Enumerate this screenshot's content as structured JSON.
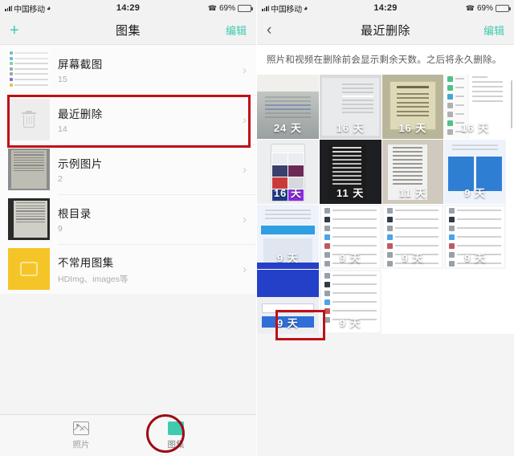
{
  "status_bar": {
    "carrier": "中国移动",
    "time": "14:29",
    "battery_percent": "69%",
    "battery_level": 69,
    "wifi_icon": "wifi-icon",
    "signal_icon": "signal-bars-icon",
    "call_icon": "call-forward-icon",
    "battery_icon": "battery-charging-icon"
  },
  "left_screen": {
    "nav": {
      "add_label": "+",
      "title": "图集",
      "edit_label": "编辑",
      "add_icon": "plus-icon"
    },
    "albums": [
      {
        "name": "屏幕截图",
        "count": "15",
        "thumb": "list-screenshot",
        "chevron": "›"
      },
      {
        "name": "最近删除",
        "count": "14",
        "thumb": "trash-icon",
        "chevron": "›",
        "highlighted": true
      },
      {
        "name": "示例图片",
        "count": "2",
        "thumb": "document-photo",
        "chevron": "›"
      },
      {
        "name": "根目录",
        "count": "9",
        "thumb": "document-photo-dark",
        "chevron": "›"
      },
      {
        "name": "不常用图集",
        "count": "HDImg、images等",
        "thumb": "yellow-folder",
        "chevron": "›"
      }
    ],
    "tabs": [
      {
        "label": "照片",
        "icon": "photo-icon",
        "active": false
      },
      {
        "label": "图集",
        "icon": "album-icon",
        "active": true,
        "annotated": true
      }
    ]
  },
  "right_screen": {
    "nav": {
      "back_icon": "back-chevron-icon",
      "title": "最近删除",
      "edit_label": "编辑"
    },
    "hint": "照片和视频在删除前会显示剩余天数。之后将永久删除。",
    "grid": [
      {
        "days": "24 天",
        "art": "v-doc",
        "highlighted": false
      },
      {
        "days": "16 天",
        "art": "v-form",
        "highlighted": false
      },
      {
        "days": "16 天",
        "art": "v-notice",
        "highlighted": false
      },
      {
        "days": "16 天",
        "art": "v-app",
        "highlighted": false
      },
      {
        "days": "16 天",
        "art": "v-phone",
        "highlighted": false
      },
      {
        "days": "11 天",
        "art": "v-night",
        "highlighted": false
      },
      {
        "days": "11 天",
        "art": "v-wall",
        "highlighted": false
      },
      {
        "days": "9 天",
        "art": "v-blue",
        "highlighted": false
      },
      {
        "days": "9 天",
        "art": "v-blue",
        "highlighted": false
      },
      {
        "days": "9 天",
        "art": "v-file",
        "highlighted": false
      },
      {
        "days": "9 天",
        "art": "v-file",
        "highlighted": false
      },
      {
        "days": "9 天",
        "art": "v-file",
        "highlighted": false
      },
      {
        "days": "9 天",
        "art": "v-chat",
        "highlighted": true
      },
      {
        "days": "9 天",
        "art": "v-file",
        "highlighted": false
      },
      {
        "days": "",
        "art": "empty",
        "highlighted": false
      },
      {
        "days": "",
        "art": "empty",
        "highlighted": false
      }
    ]
  },
  "colors": {
    "accent_teal": "#3fcbb0",
    "annotation_red": "#c00f18",
    "battery_green": "#25c65c",
    "folder_yellow": "#f5c528"
  }
}
